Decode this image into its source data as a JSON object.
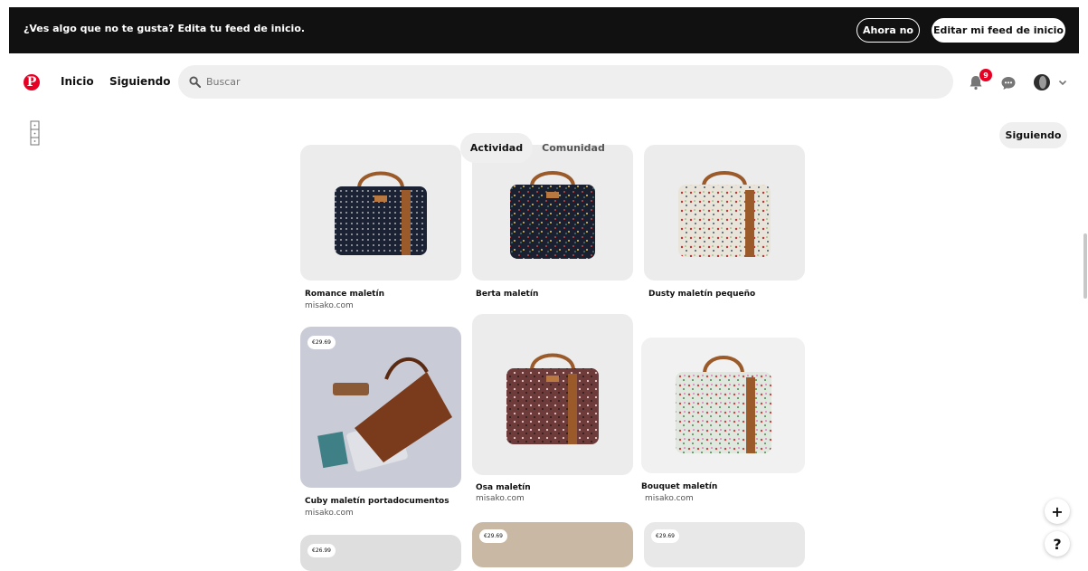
{
  "banner": {
    "message": "¿Ves algo que no te gusta? Edita tu feed de inicio.",
    "dismiss_label": "Ahora no",
    "edit_label": "Editar mi feed de inicio"
  },
  "nav": {
    "logo": "P",
    "home": "Inicio",
    "following": "Siguiendo",
    "search_placeholder": "Buscar",
    "notifications_count": "9"
  },
  "tabs": {
    "activity": "Actividad",
    "community": "Comunidad"
  },
  "follow_button": "Siguiendo",
  "pins": [
    {
      "title": "Romance maletín",
      "domain": "misako.com",
      "price": "",
      "bag_color": "#1a2233",
      "pattern": "dots"
    },
    {
      "title": "Berta maletín",
      "domain": "",
      "price": "",
      "bag_color": "#1b2030",
      "pattern": "floral-dark"
    },
    {
      "title": "Dusty maletín pequeño",
      "domain": "",
      "price": "",
      "bag_color": "#e9e4da",
      "pattern": "floral-light"
    },
    {
      "title": "Cuby maletín portadocumentos",
      "domain": "misako.com",
      "price": "€29.69",
      "bag_color": "#7a3a1c",
      "pattern": "leather"
    },
    {
      "title": "Osa maletín",
      "domain": "misako.com",
      "price": "",
      "bag_color": "#6e3b3b",
      "pattern": "floral-red"
    },
    {
      "title": "Bouquet maletín",
      "domain": "misako.com",
      "price": "",
      "bag_color": "#dfe7df",
      "pattern": "floral-green"
    },
    {
      "title": "",
      "domain": "",
      "price": "€26.99",
      "bag_color": "#dedede",
      "pattern": "none"
    },
    {
      "title": "",
      "domain": "",
      "price": "€29.69",
      "bag_color": "#c9b8a4",
      "pattern": "none"
    },
    {
      "title": "",
      "domain": "",
      "price": "€29.69",
      "bag_color": "#e8e8e8",
      "pattern": "none"
    }
  ],
  "fab": {
    "add": "+",
    "help": "?"
  },
  "colors": {
    "brand": "#e60023",
    "banner_bg": "#111111",
    "surface": "#efefef",
    "leather": "#9a5a2a"
  }
}
